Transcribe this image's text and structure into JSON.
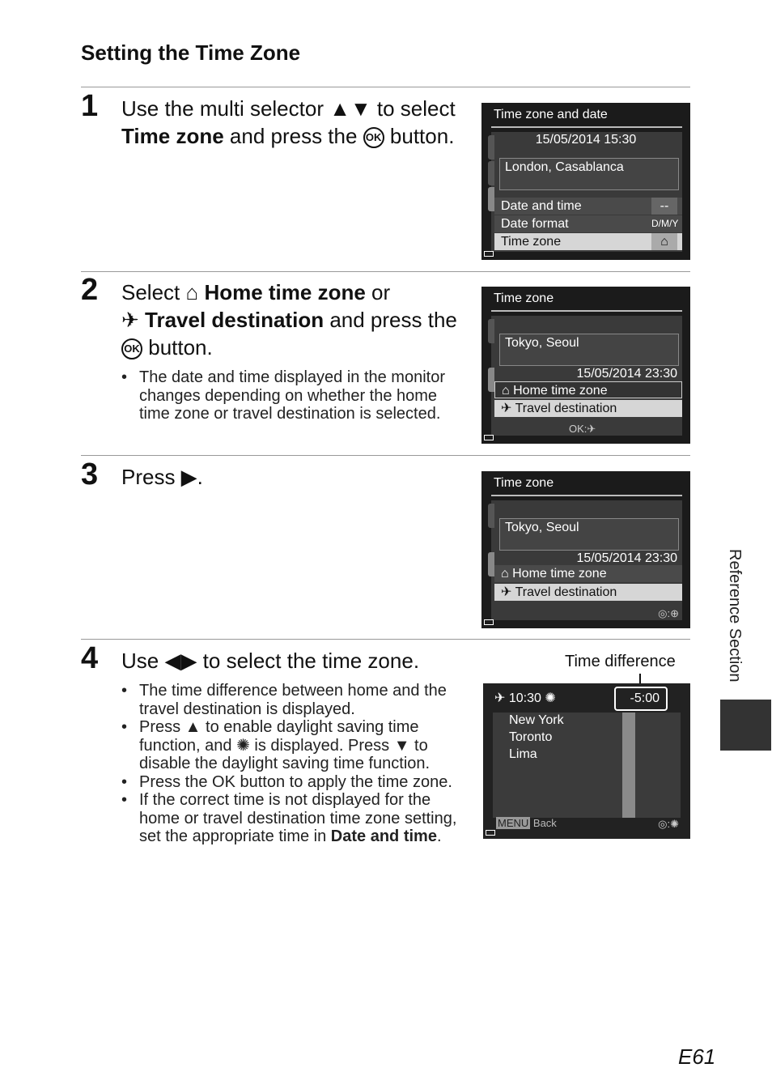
{
  "title": "Setting the Time Zone",
  "steps": [
    {
      "num": "1",
      "a": "Use the multi selector ▲▼ to select ",
      "b": "Time zone",
      "c": " and press the ",
      "d": "button."
    },
    {
      "num": "2",
      "a": "Select ",
      "b": "Home time zone",
      "c": " or ",
      "d": "Travel destination",
      "e": " and press the ",
      "f": "button.",
      "bullets": [
        "The date and time displayed in the monitor changes depending on whether the home time zone or travel destination is selected."
      ]
    },
    {
      "num": "3",
      "a": "Press ▶."
    },
    {
      "num": "4",
      "a": "Use ◀▶ to select the time zone.",
      "bullets": [
        "The time difference between home and the travel destination is displayed.",
        "Press ▲ to enable daylight saving time function, and ✺ is displayed. Press ▼ to disable the daylight saving time function.",
        "Press the OK button to apply the time zone."
      ],
      "last_a": "If the correct time is not displayed for the home or travel destination time zone setting, set the appropriate time in ",
      "last_b": "Date and time",
      "last_c": "."
    }
  ],
  "ok_label": "OK",
  "screen1": {
    "title": "Time zone and date",
    "datetime": "15/05/2014  15:30",
    "city": "London, Casablanca",
    "rows": [
      {
        "label": "Date and time",
        "value": "--"
      },
      {
        "label": "Date format",
        "value": "D/M/Y"
      },
      {
        "label": "Time zone",
        "value": "⌂"
      }
    ]
  },
  "screen2": {
    "title": "Time zone",
    "city": "Tokyo, Seoul",
    "datetime": "15/05/2014  23:30",
    "home": "Home time zone",
    "travel": "Travel destination",
    "footer": "OK:✈"
  },
  "screen3": {
    "title": "Time zone",
    "city": "Tokyo, Seoul",
    "datetime": "15/05/2014  23:30",
    "home": "Home time zone",
    "travel": "Travel destination",
    "footer": "◎:⊕"
  },
  "screen4": {
    "callout": "Time difference",
    "time": "10:30",
    "diff": "-5:00",
    "cities": [
      "New York",
      "Toronto",
      "Lima"
    ],
    "menu": "MENU",
    "back": "Back",
    "footer": "◎:✺"
  },
  "side_label": "Reference Section",
  "page_number": "E61"
}
